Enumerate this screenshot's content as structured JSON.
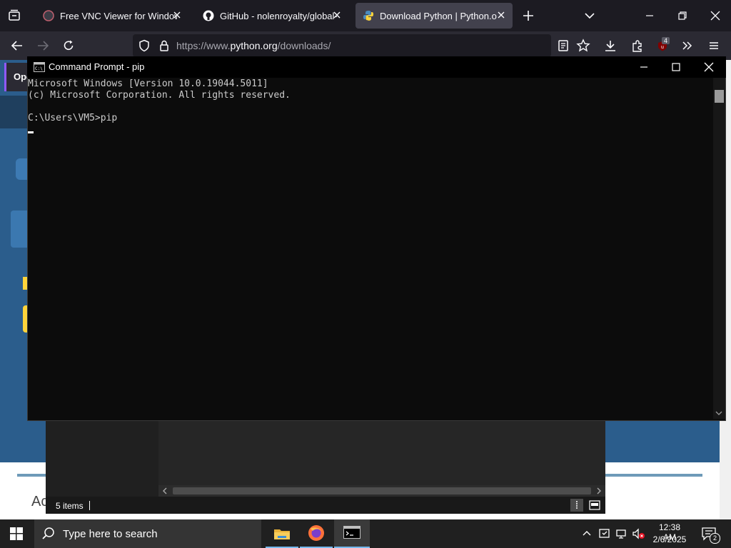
{
  "browser": {
    "tabs": [
      {
        "title": "Free VNC Viewer for Windows, |",
        "active": false
      },
      {
        "title": "GitHub - nolenroyalty/global-c",
        "active": false
      },
      {
        "title": "Download Python | Python.org",
        "active": true
      }
    ],
    "url_prefix": "https://www.",
    "url_domain": "python.org",
    "url_path": "/downloads/",
    "extension_badge": "4"
  },
  "page": {
    "bg_text_1": "Ope",
    "bg_text_2": "Ac"
  },
  "cmd": {
    "title": "Command Prompt - pip",
    "lines": [
      "Microsoft Windows [Version 10.0.19044.5011]",
      "(c) Microsoft Corporation. All rights reserved.",
      "",
      "C:\\Users\\VM5>pip"
    ]
  },
  "explorer": {
    "status": "5 items"
  },
  "taskbar": {
    "search_placeholder": "Type here to search",
    "time": "12:38 AM",
    "date": "2/6/2025",
    "notification_count": "2"
  },
  "colors": {
    "accent": "#2b5d8c",
    "console_bg": "#0c0c0c",
    "console_text": "#cccccc"
  }
}
